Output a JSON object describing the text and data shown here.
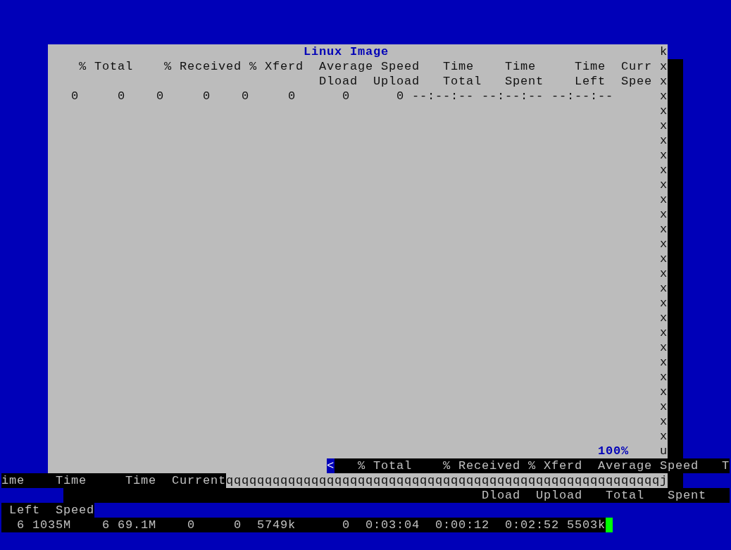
{
  "dialog": {
    "title": "Linux Image",
    "header_top": [
      "% Total",
      "% Received",
      "% Xferd",
      "Average",
      "Speed",
      "Time",
      "Time",
      "Time",
      "Curr"
    ],
    "header_bottom": [
      "Dload",
      "Upload",
      "Total",
      "Spent",
      "Left",
      "Spee"
    ],
    "values": [
      "0",
      "0",
      "0",
      "0",
      "0",
      "0",
      "0",
      "0",
      "--:--:--",
      "--:--:--",
      "--:--:--"
    ],
    "border_right": [
      "k",
      "x",
      "x",
      "x",
      "x",
      "x",
      "x",
      "x",
      "x",
      "x",
      "x",
      "x",
      "x",
      "x",
      "x",
      "x",
      "x",
      "x",
      "x",
      "x",
      "x",
      "x",
      "x",
      "x",
      "x",
      "x",
      "x",
      "u"
    ],
    "gauge": "100%"
  },
  "gauge_line": {
    "arrow": "<",
    "labels": [
      "% Total",
      "% Received",
      "% Xferd",
      "Average",
      "Speed",
      "T"
    ]
  },
  "terminal": {
    "line_1": [
      "ime",
      "Time",
      "Time",
      "Current"
    ],
    "rule": "qqqqqqqqqqqqqqqqqqqqqqqqqqqqqqqqqqqqqqqqqqqqqqqqqqqqqqqqj",
    "line_2": [
      "Dload",
      "Upload",
      "Total",
      "Spent"
    ],
    "line_3": [
      "Left",
      "Speed"
    ],
    "line_4": [
      "6",
      "1035M",
      "6",
      "69.1M",
      "0",
      "0",
      "5749k",
      "0",
      "0:03:04",
      "0:00:12",
      "0:02:52",
      "5503k"
    ]
  }
}
